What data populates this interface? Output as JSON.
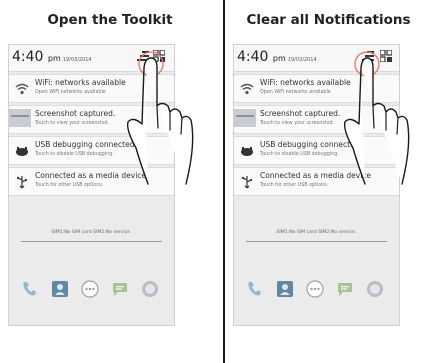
{
  "panels": [
    {
      "title": "Open the Toolkit",
      "clock": {
        "time": "4:40",
        "ampm": "pm",
        "date": "19/03/2014"
      },
      "notifications": [
        {
          "title": "WiFi: networks available",
          "subtitle": "Open WiFi networks available",
          "icon": "wifi-icon"
        },
        {
          "title": "Screenshot captured.",
          "subtitle": "Touch to view your screenshot.",
          "icon": "screenshot-thumbnail"
        },
        {
          "title": "USB debugging connected",
          "subtitle": "Touch to disable USB debugging.",
          "icon": "android-debug-icon"
        },
        {
          "title": "Connected as a media device",
          "subtitle": "Touch for other USB options.",
          "icon": "usb-icon"
        }
      ],
      "sim_status": "SIM1:No SIM card   SIM2:No service."
    },
    {
      "title": "Clear all Notifications",
      "clock": {
        "time": "4:40",
        "ampm": "pm",
        "date": "19/03/2014"
      },
      "notifications": [
        {
          "title": "WiFi: networks available",
          "subtitle": "Open WiFi networks available",
          "icon": "wifi-icon"
        },
        {
          "title": "Screenshot captured.",
          "subtitle": "Touch to view your screenshot.",
          "icon": "screenshot-thumbnail"
        },
        {
          "title": "USB debugging connected",
          "subtitle": "Touch to disable USB debugging.",
          "icon": "android-debug-icon"
        },
        {
          "title": "Connected as a media device",
          "subtitle": "Touch for other USB options.",
          "icon": "usb-icon"
        }
      ],
      "sim_status": "SIM1:No SIM card   SIM2:No service."
    }
  ],
  "colors": {
    "highlight_circle": "#e8736a",
    "dock_phone": "#8fb9cf",
    "dock_contacts": "#5f88a4",
    "dock_apps": "#9aa4ae",
    "dock_messages": "#a8c58f",
    "dock_browser": "#b9bec4"
  },
  "icons": {
    "clear_all": "clear-all-icon",
    "toolkit": "toolkit-grid-icon",
    "hand": "pointing-hand-icon",
    "dock": [
      "phone-icon",
      "contacts-icon",
      "apps-icon",
      "messages-icon",
      "browser-icon"
    ]
  }
}
